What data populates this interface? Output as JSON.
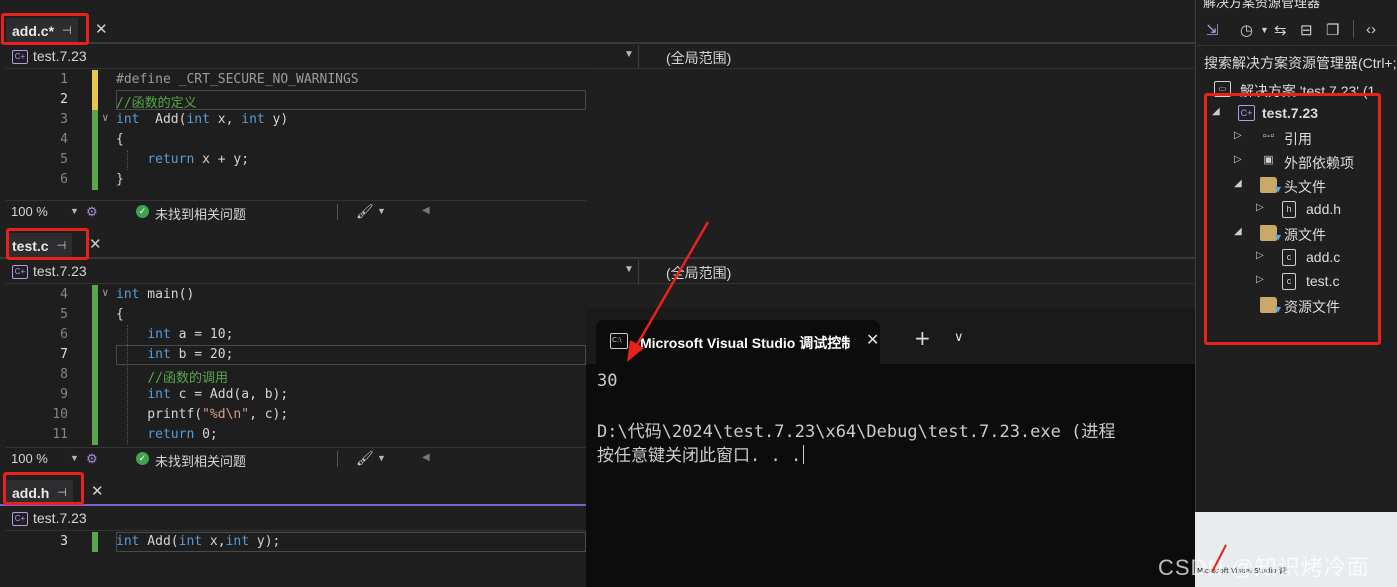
{
  "colors": {
    "accent_red": "#e8221b",
    "keyword": "#569cd6",
    "comment": "#57a64a",
    "change_bar_saved": "#57a64a",
    "change_bar_unsaved": "#e8c64b",
    "project_purple": "#b49ae8"
  },
  "panes": {
    "add_c": {
      "tab_label": "add.c*",
      "project": "test.7.23",
      "scope": "(全局范围)",
      "lines": [
        {
          "num": "1",
          "parts": [
            {
              "t": "#define _CRT_SECURE_NO_WARNINGS",
              "c": "pp"
            }
          ]
        },
        {
          "num": "2",
          "parts": [
            {
              "t": "//函数的定义",
              "c": "cm"
            }
          ]
        },
        {
          "num": "3",
          "parts": [
            {
              "t": "int",
              "c": "kw"
            },
            {
              "t": "  Add(",
              "c": "pl"
            },
            {
              "t": "int",
              "c": "kw"
            },
            {
              "t": " x, ",
              "c": "pl"
            },
            {
              "t": "int",
              "c": "kw"
            },
            {
              "t": " y)",
              "c": "pl"
            }
          ]
        },
        {
          "num": "4",
          "parts": [
            {
              "t": "{",
              "c": "pl"
            }
          ]
        },
        {
          "num": "5",
          "parts": [
            {
              "t": "    ",
              "c": "pl"
            },
            {
              "t": "return",
              "c": "kw"
            },
            {
              "t": " x + y;",
              "c": "pl"
            }
          ]
        },
        {
          "num": "6",
          "parts": [
            {
              "t": "}",
              "c": "pl"
            }
          ]
        }
      ],
      "zoom": "100 %",
      "status": "未找到相关问题"
    },
    "test_c": {
      "tab_label": "test.c",
      "project": "test.7.23",
      "scope": "(全局范围)",
      "lines": [
        {
          "num": "4",
          "parts": [
            {
              "t": "int",
              "c": "kw"
            },
            {
              "t": " main()",
              "c": "pl"
            }
          ]
        },
        {
          "num": "5",
          "parts": [
            {
              "t": "{",
              "c": "pl"
            }
          ]
        },
        {
          "num": "6",
          "parts": [
            {
              "t": "    ",
              "c": "pl"
            },
            {
              "t": "int",
              "c": "kw"
            },
            {
              "t": " a = 10;",
              "c": "pl"
            }
          ]
        },
        {
          "num": "7",
          "parts": [
            {
              "t": "    ",
              "c": "pl"
            },
            {
              "t": "int",
              "c": "kw"
            },
            {
              "t": " b = 20;",
              "c": "pl"
            }
          ]
        },
        {
          "num": "8",
          "parts": [
            {
              "t": "    ",
              "c": "pl"
            },
            {
              "t": "//函数的调用",
              "c": "cm"
            }
          ]
        },
        {
          "num": "9",
          "parts": [
            {
              "t": "    ",
              "c": "pl"
            },
            {
              "t": "int",
              "c": "kw"
            },
            {
              "t": " c = Add(a, b);",
              "c": "pl"
            }
          ]
        },
        {
          "num": "10",
          "parts": [
            {
              "t": "    printf(",
              "c": "pl"
            },
            {
              "t": "\"%d\\n\"",
              "c": "st"
            },
            {
              "t": ", c);",
              "c": "pl"
            }
          ]
        },
        {
          "num": "11",
          "parts": [
            {
              "t": "    ",
              "c": "pl"
            },
            {
              "t": "return",
              "c": "kw"
            },
            {
              "t": " 0;",
              "c": "pl"
            }
          ]
        }
      ],
      "zoom": "100 %",
      "status": "未找到相关问题"
    },
    "add_h": {
      "tab_label": "add.h",
      "project": "test.7.23",
      "lines": [
        {
          "num": "3",
          "parts": [
            {
              "t": "int",
              "c": "kw"
            },
            {
              "t": " Add(",
              "c": "pl"
            },
            {
              "t": "int",
              "c": "kw"
            },
            {
              "t": " x,",
              "c": "pl"
            },
            {
              "t": "int",
              "c": "kw"
            },
            {
              "t": " y);",
              "c": "pl"
            }
          ]
        }
      ]
    }
  },
  "console": {
    "tab_title": "Microsoft Visual Studio 调试控制台",
    "output_value": "30",
    "exit_line": "D:\\代码\\2024\\test.7.23\\x64\\Debug\\test.7.23.exe (进程",
    "prompt_line": "按任意键关闭此窗口. . ."
  },
  "solution_explorer": {
    "title": "解决方案资源管理器",
    "search_placeholder": "搜索解决方案资源管理器(Ctrl+;)",
    "solution_label": "解决方案 'test.7.23' (1",
    "tree": [
      {
        "label": "test.7.23",
        "icon": "project",
        "expander": "expanded",
        "level": 0,
        "bold": true
      },
      {
        "label": "引用",
        "icon": "references",
        "expander": "collapsed",
        "level": 1
      },
      {
        "label": "外部依赖项",
        "icon": "external-deps",
        "expander": "collapsed",
        "level": 1
      },
      {
        "label": "头文件",
        "icon": "filter-folder",
        "expander": "expanded",
        "level": 1
      },
      {
        "label": "add.h",
        "icon": "header-file",
        "expander": "collapsed",
        "level": 2
      },
      {
        "label": "源文件",
        "icon": "filter-folder",
        "expander": "expanded",
        "level": 1
      },
      {
        "label": "add.c",
        "icon": "c-file",
        "expander": "collapsed",
        "level": 2
      },
      {
        "label": "test.c",
        "icon": "c-file",
        "expander": "collapsed",
        "level": 2
      },
      {
        "label": "资源文件",
        "icon": "filter-folder",
        "expander": "none",
        "level": 1
      }
    ]
  },
  "taskbar_thumb": "Microsoft Visual Studio 调试控制台",
  "watermark": "CSDN @知识烤冷面"
}
